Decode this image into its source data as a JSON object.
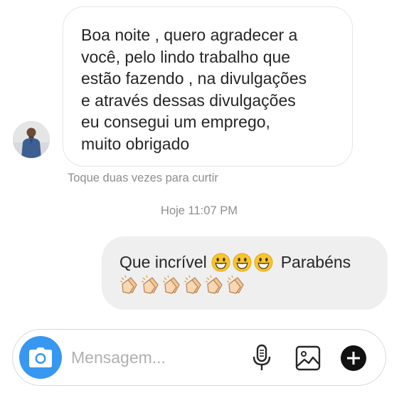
{
  "conversation": {
    "incoming": {
      "text": "Boa noite , quero agradecer a\nvocê, pelo lindo trabalho que\nestão fazendo , na divulgações\ne através dessas divulgações\neu consegui um emprego,\nmuito obrigado",
      "like_hint": "Toque duas vezes para curtir"
    },
    "timestamp": "Hoje 11:07 PM",
    "outgoing": {
      "text_before": "Que incrível",
      "emoji_smiley_count": 3,
      "text_after": "Parabéns",
      "emoji_clap_count": 6
    }
  },
  "composer": {
    "placeholder": "Mensagem...",
    "value": "",
    "icons": [
      "camera-icon",
      "microphone-icon",
      "gallery-icon",
      "plus-icon"
    ]
  },
  "colors": {
    "accent": "#3897f0",
    "outgoing_bubble": "#efefef",
    "secondary_text": "#8e8e8e"
  }
}
